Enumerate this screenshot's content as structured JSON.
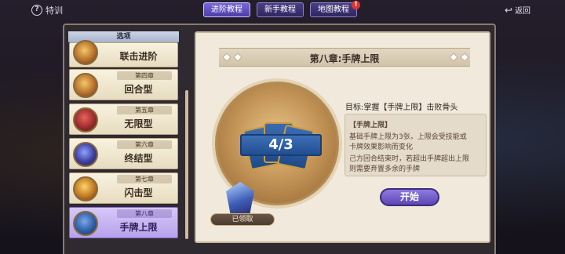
{
  "topbar": {
    "training_label": "特训",
    "tabs": [
      {
        "label": "进阶教程",
        "active": true
      },
      {
        "label": "新手教程",
        "active": false
      },
      {
        "label": "地图教程",
        "active": false,
        "badge": "!"
      }
    ],
    "back_label": "返回"
  },
  "sidebar": {
    "header": "选项",
    "items": [
      {
        "chapter": "",
        "label": "联击进阶"
      },
      {
        "chapter": "第四章",
        "label": "回合型"
      },
      {
        "chapter": "第五章",
        "label": "无限型"
      },
      {
        "chapter": "第六章",
        "label": "终结型"
      },
      {
        "chapter": "第七章",
        "label": "闪击型"
      },
      {
        "chapter": "第八章",
        "label": "手牌上限",
        "selected": true
      }
    ]
  },
  "content": {
    "title": "第八章:手牌上限",
    "art_counter": "4/3",
    "claimed_label": "已领取",
    "objective": "目标:掌握【手牌上限】击败骨头",
    "info_title": "【手牌上限】",
    "info_lines": [
      "基础手牌上限为3张，上限会受技能或",
      "卡牌效果影响而变化",
      "己方回合结束时，若超出手牌超出上限",
      "则需要弃置多余的手牌"
    ],
    "start_label": "开始"
  },
  "colors": {
    "accent": "#6a55c9",
    "card_bg": "#f0e9dc",
    "ribbon": "#2f5fa6"
  }
}
